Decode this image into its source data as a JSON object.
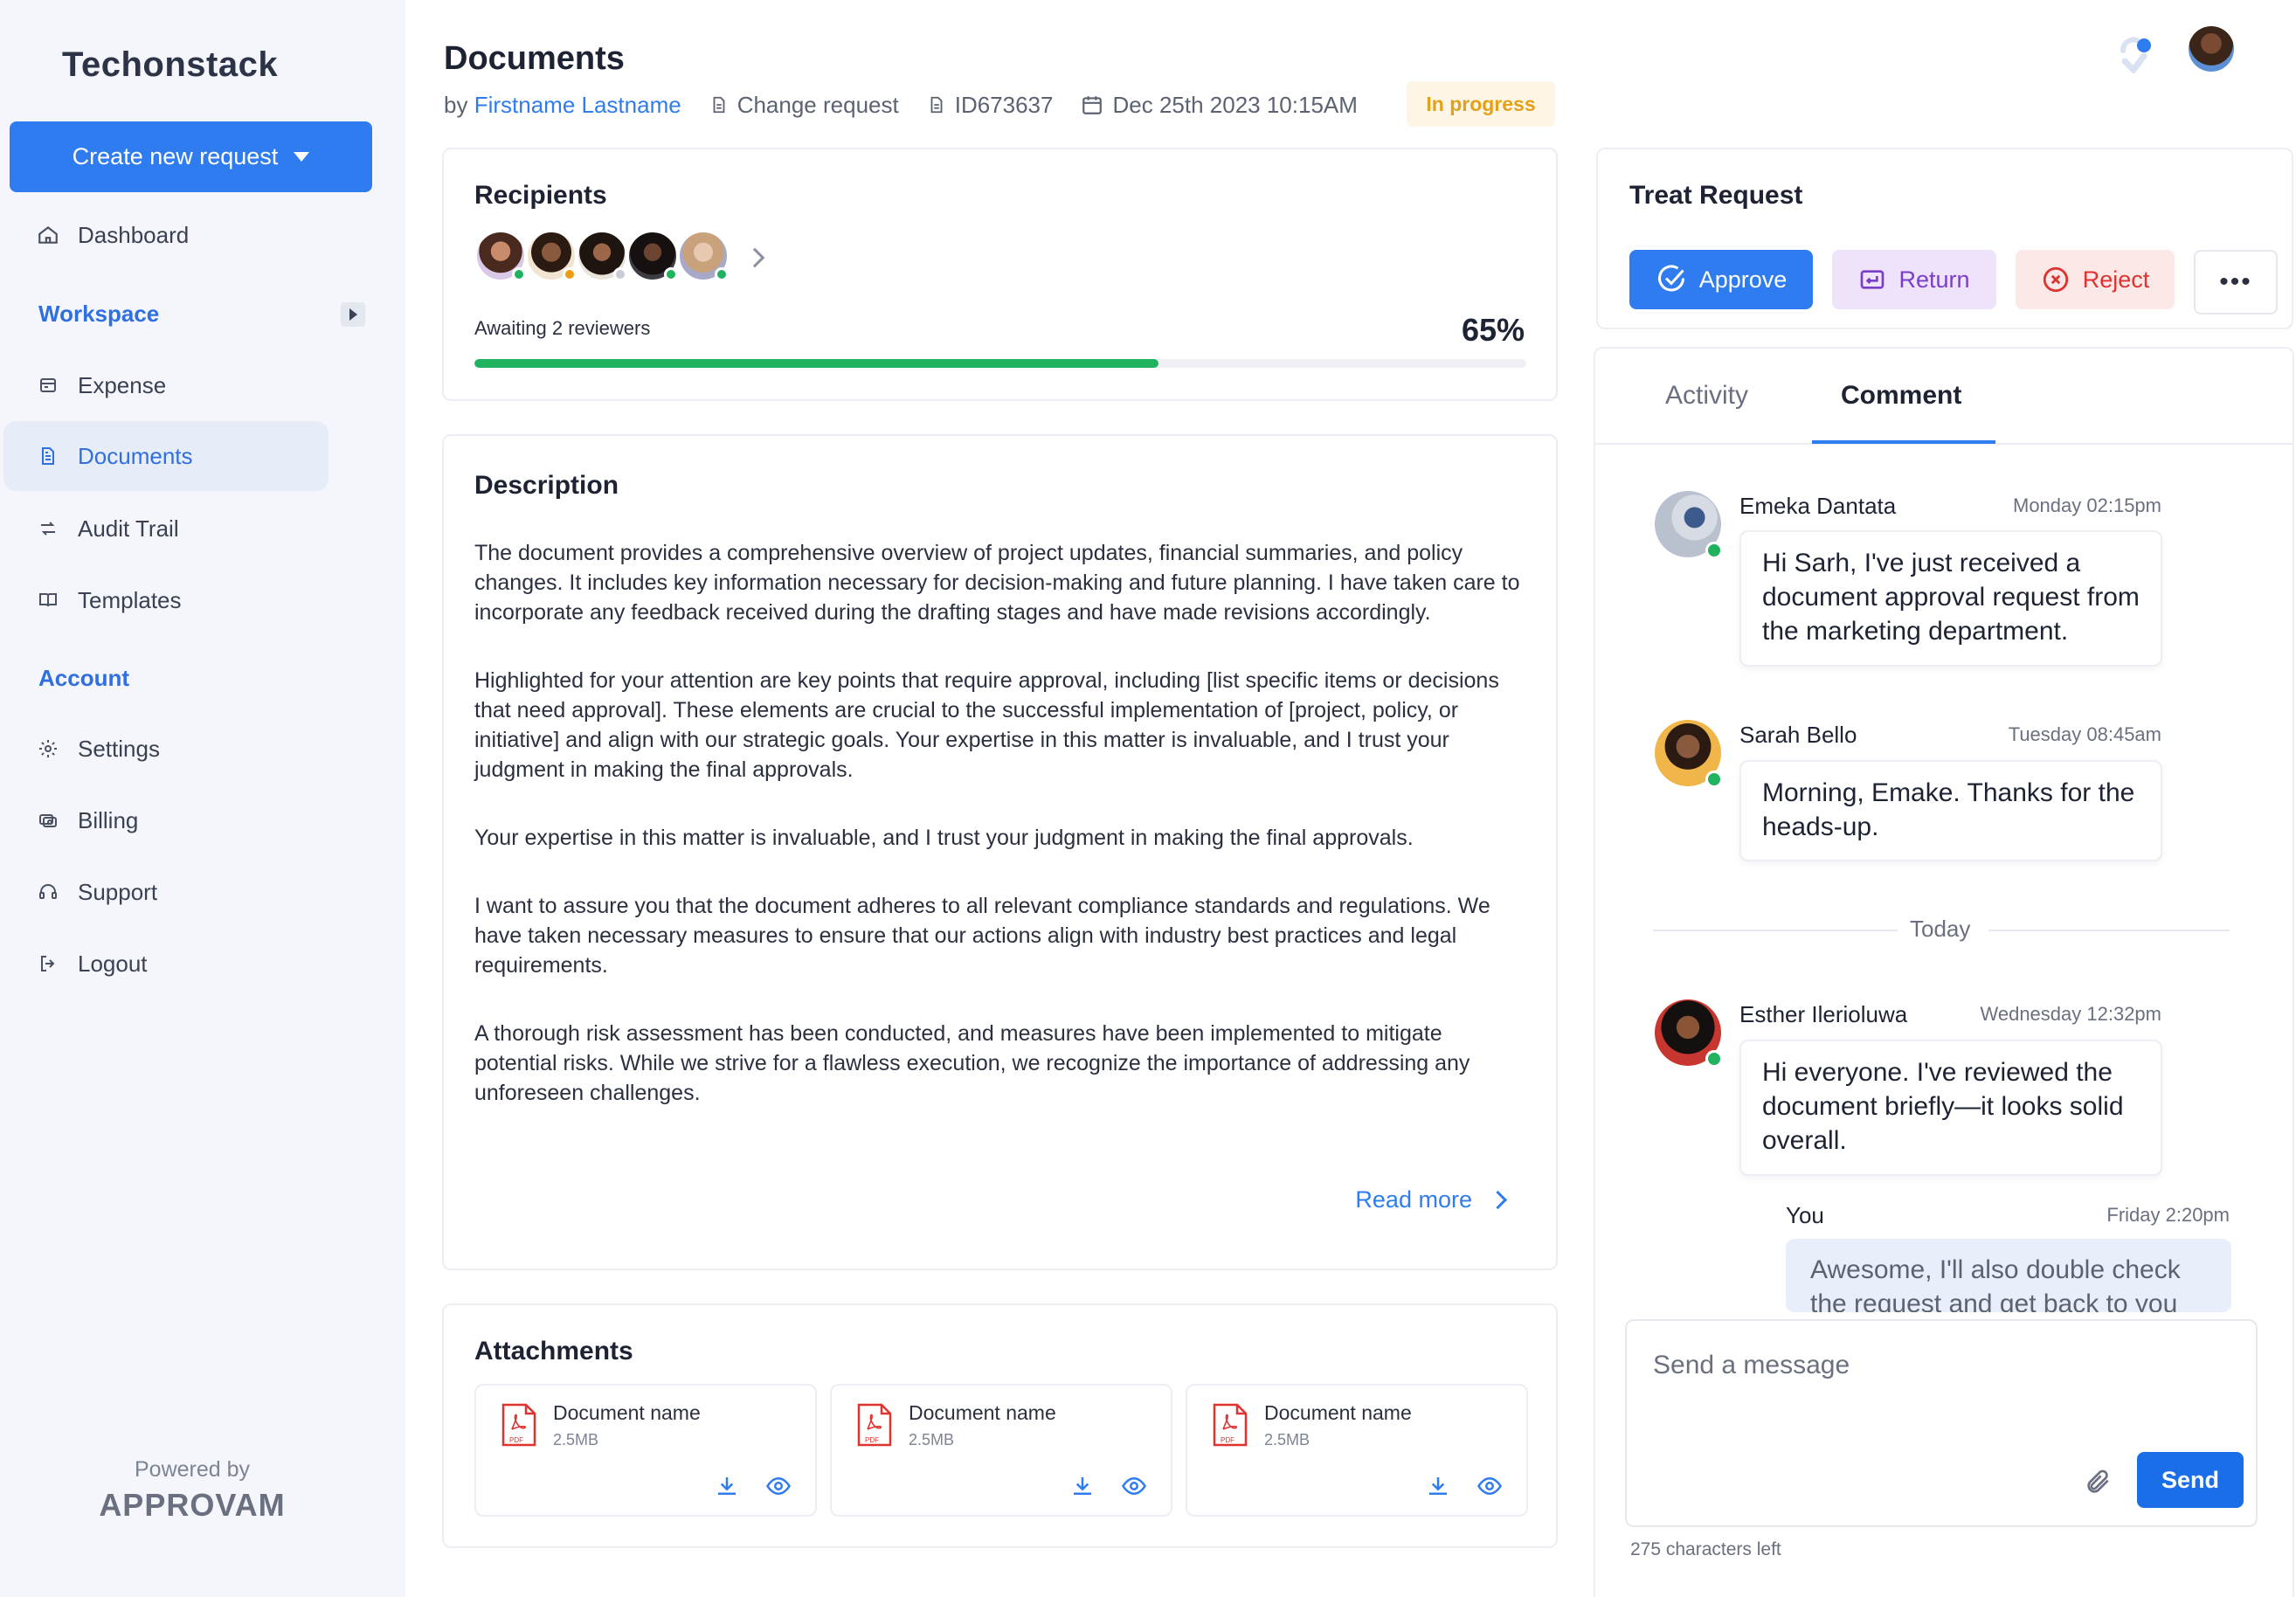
{
  "sidebar": {
    "brand": "Techonstack",
    "create_button": "Create new request",
    "items": {
      "dashboard": "Dashboard",
      "expense": "Expense",
      "documents": "Documents",
      "audit_trail": "Audit Trail",
      "templates": "Templates",
      "settings": "Settings",
      "billing": "Billing",
      "support": "Support",
      "logout": "Logout"
    },
    "workspace_label": "Workspace",
    "account_label": "Account",
    "powered_by": "Powered by",
    "powered_brand": "APPROVAM"
  },
  "header": {
    "title": "Documents",
    "by_prefix": "by",
    "author": "Firstname Lastname",
    "type": "Change request",
    "id": "ID673637",
    "date": "Dec 25th 2023 10:15AM",
    "status": "In progress"
  },
  "recipients": {
    "title": "Recipients",
    "awaiting": "Awaiting 2 reviewers",
    "percent_label": "65%",
    "progress": 0.65,
    "status_colors": [
      "#1fb35f",
      "#f09b14",
      "#c7ccd6",
      "#1fb35f",
      "#1fb35f"
    ]
  },
  "description": {
    "title": "Description",
    "paragraphs": [
      "The document provides a comprehensive overview of project updates, financial summaries, and policy changes. It includes key information necessary for decision-making and future planning. I have taken care to incorporate any feedback received during the drafting stages and have made revisions accordingly.",
      "Highlighted for your attention are key points that require approval, including [list specific items or decisions that need approval]. These elements are crucial to the successful implementation of [project, policy, or initiative] and align with our strategic goals. Your expertise in this matter is invaluable, and I trust your judgment in making the final approvals.",
      "Your expertise in this matter is invaluable, and I trust your judgment in making the final approvals.",
      "I want to assure you that the document adheres to all relevant compliance standards and regulations. We have taken necessary measures to ensure that our actions align with industry best practices and legal requirements.",
      "A thorough risk assessment has been conducted, and measures have been implemented to mitigate potential risks. While we strive for a flawless execution, we recognize the importance of addressing any unforeseen challenges."
    ],
    "read_more": "Read more"
  },
  "attachments": {
    "title": "Attachments",
    "files": [
      {
        "name": "Document name",
        "size": "2.5MB"
      },
      {
        "name": "Document name",
        "size": "2.5MB"
      },
      {
        "name": "Document name",
        "size": "2.5MB"
      }
    ]
  },
  "treat": {
    "title": "Treat Request",
    "approve": "Approve",
    "return": "Return",
    "reject": "Reject",
    "more": "•••"
  },
  "tabs": {
    "activity": "Activity",
    "comment": "Comment"
  },
  "comments": [
    {
      "name": "Emeka Dantata",
      "time": "Monday 02:15pm",
      "text": "Hi Sarh, I've just received a document approval request from the marketing department."
    },
    {
      "name": "Sarah Bello",
      "time": "Tuesday 08:45am",
      "text": "Morning, Emake. Thanks for the heads-up."
    },
    {
      "name": "Esther Ilerioluwa",
      "time": "Wednesday 12:32pm",
      "text": "Hi everyone. I've reviewed the document briefly—it looks solid overall."
    }
  ],
  "divider": "Today",
  "you": {
    "name": "You",
    "time": "Friday 2:20pm",
    "text": "Awesome, I'll also double check the request and get back to you"
  },
  "composer": {
    "placeholder": "Send a message",
    "send": "Send",
    "chars_left": "275 characters left"
  }
}
